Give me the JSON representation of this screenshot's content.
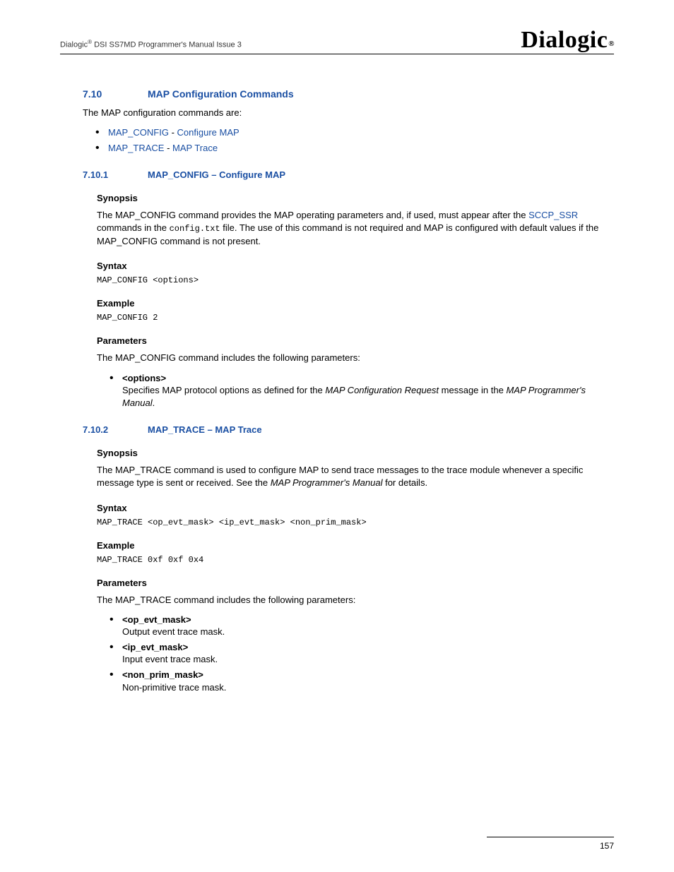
{
  "header": {
    "left_prefix": "Dialogic",
    "left_suffix": " DSI SS7MD Programmer's Manual  Issue 3",
    "logo_text": "Dialogic",
    "logo_reg": "®"
  },
  "sec_7_10": {
    "num": "7.10",
    "title": "MAP Configuration Commands",
    "intro": "The MAP configuration commands are:",
    "bullets": [
      {
        "link1": "MAP_CONFIG",
        "sep": " - ",
        "link2": "Configure MAP"
      },
      {
        "link1": "MAP_TRACE",
        "sep": " - ",
        "link2": "MAP Trace"
      }
    ]
  },
  "sec_7_10_1": {
    "num": "7.10.1",
    "title": "MAP_CONFIG – Configure MAP",
    "synopsis_h": "Synopsis",
    "synopsis_p1a": "The MAP_CONFIG command provides the MAP operating parameters and, if used, must appear after the ",
    "synopsis_link": "SCCP_SSR",
    "synopsis_p1b": " commands in the ",
    "synopsis_mono": "config.txt",
    "synopsis_p1c": " file. The use of this command is not required and MAP is configured with default values if the MAP_CONFIG command is not present.",
    "syntax_h": "Syntax",
    "syntax_code": "MAP_CONFIG <options>",
    "example_h": "Example",
    "example_code": "MAP_CONFIG 2",
    "params_h": "Parameters",
    "params_intro": "The MAP_CONFIG command includes the following parameters:",
    "param_name": "<options>",
    "param_desc_a": "Specifies MAP protocol options as defined for the ",
    "param_desc_i1": "MAP Configuration Request",
    "param_desc_b": " message in the ",
    "param_desc_i2": "MAP Programmer's Manual",
    "param_desc_c": "."
  },
  "sec_7_10_2": {
    "num": "7.10.2",
    "title": "MAP_TRACE – MAP Trace",
    "synopsis_h": "Synopsis",
    "synopsis_a": "The MAP_TRACE command is used to configure MAP to send trace messages to the trace module whenever a specific message type is sent or received. See the ",
    "synopsis_i": "MAP Programmer's Manual",
    "synopsis_b": " for details.",
    "syntax_h": "Syntax",
    "syntax_code": "MAP_TRACE <op_evt_mask> <ip_evt_mask> <non_prim_mask>",
    "example_h": "Example",
    "example_code": "MAP_TRACE 0xf 0xf 0x4",
    "params_h": "Parameters",
    "params_intro": "The MAP_TRACE command includes the following parameters:",
    "params": [
      {
        "name": "<op_evt_mask>",
        "desc": "Output event trace mask."
      },
      {
        "name": "<ip_evt_mask>",
        "desc": "Input event trace mask."
      },
      {
        "name": "<non_prim_mask>",
        "desc": "Non-primitive trace mask."
      }
    ]
  },
  "footer": {
    "page": "157"
  }
}
